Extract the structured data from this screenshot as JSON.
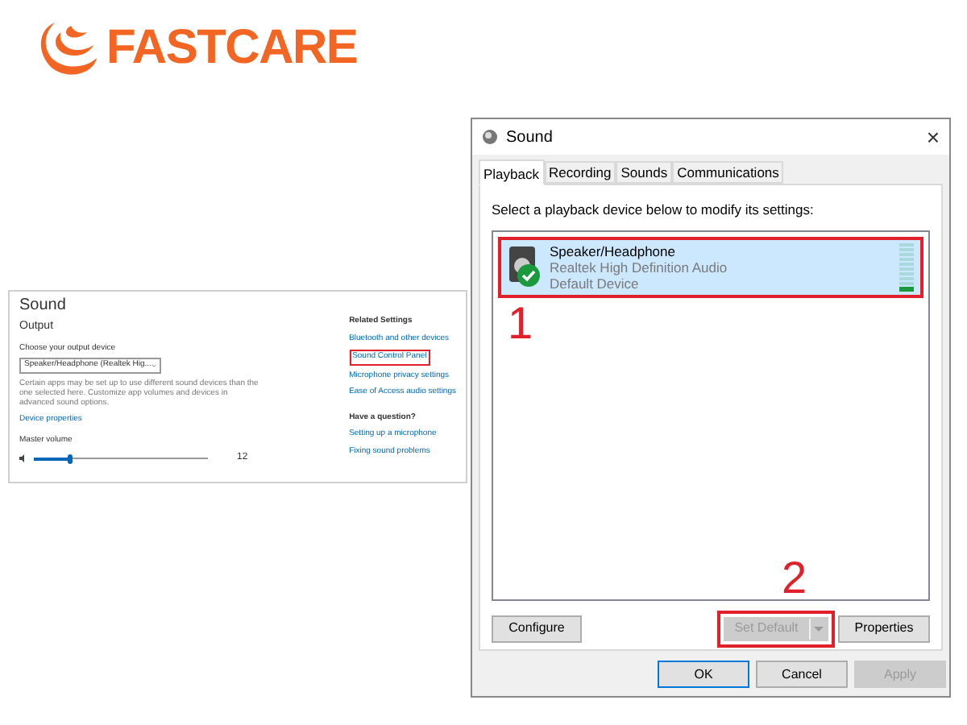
{
  "logo": {
    "text": "FASTCARE"
  },
  "settings": {
    "title": "Sound",
    "section": "Output",
    "device_label": "Choose your output device",
    "device_value": "Speaker/Headphone (Realtek Hig...",
    "note": "Certain apps may be set up to use different sound devices than the one selected here. Customize app volumes and devices in advanced sound options.",
    "device_properties_link": "Device properties",
    "volume_label": "Master volume",
    "volume": {
      "level": 0.2,
      "reading": "12"
    },
    "related_title": "Related Settings",
    "related_links": [
      {
        "text": "Bluetooth and other devices",
        "highlighted": false
      },
      {
        "text": "Sound Control Panel",
        "highlighted": true
      },
      {
        "text": "Microphone privacy settings",
        "highlighted": false
      },
      {
        "text": "Ease of Access audio settings",
        "highlighted": false
      }
    ],
    "question_title": "Have a question?",
    "question_links": [
      "Setting up a microphone",
      "Fixing sound problems"
    ]
  },
  "dialog": {
    "title": "Sound",
    "close": "×",
    "tabs": [
      {
        "label": "Playback",
        "selected": true
      },
      {
        "label": "Recording",
        "selected": false
      },
      {
        "label": "Sounds",
        "selected": false
      },
      {
        "label": "Communications",
        "selected": false
      }
    ],
    "instruction": "Select a playback device below to modify its settings:",
    "devices": [
      {
        "name": "Speaker/Headphone",
        "driver": "Realtek High Definition Audio",
        "status": "Default Device",
        "selected": true,
        "highlighted": true,
        "is_default": true,
        "level": 0.1
      }
    ],
    "markers": [
      "1",
      "2"
    ],
    "device_buttons": [
      {
        "label": "Configure",
        "disabled": false
      },
      {
        "label": "Set Default",
        "disabled": true,
        "highlighted": true,
        "dropdown": true
      },
      {
        "label": "Properties",
        "disabled": false
      }
    ],
    "dialog_buttons": [
      {
        "label": "OK",
        "default": true,
        "disabled": false
      },
      {
        "label": "Cancel",
        "default": false,
        "disabled": false
      },
      {
        "label": "Apply",
        "default": false,
        "disabled": true
      }
    ]
  }
}
